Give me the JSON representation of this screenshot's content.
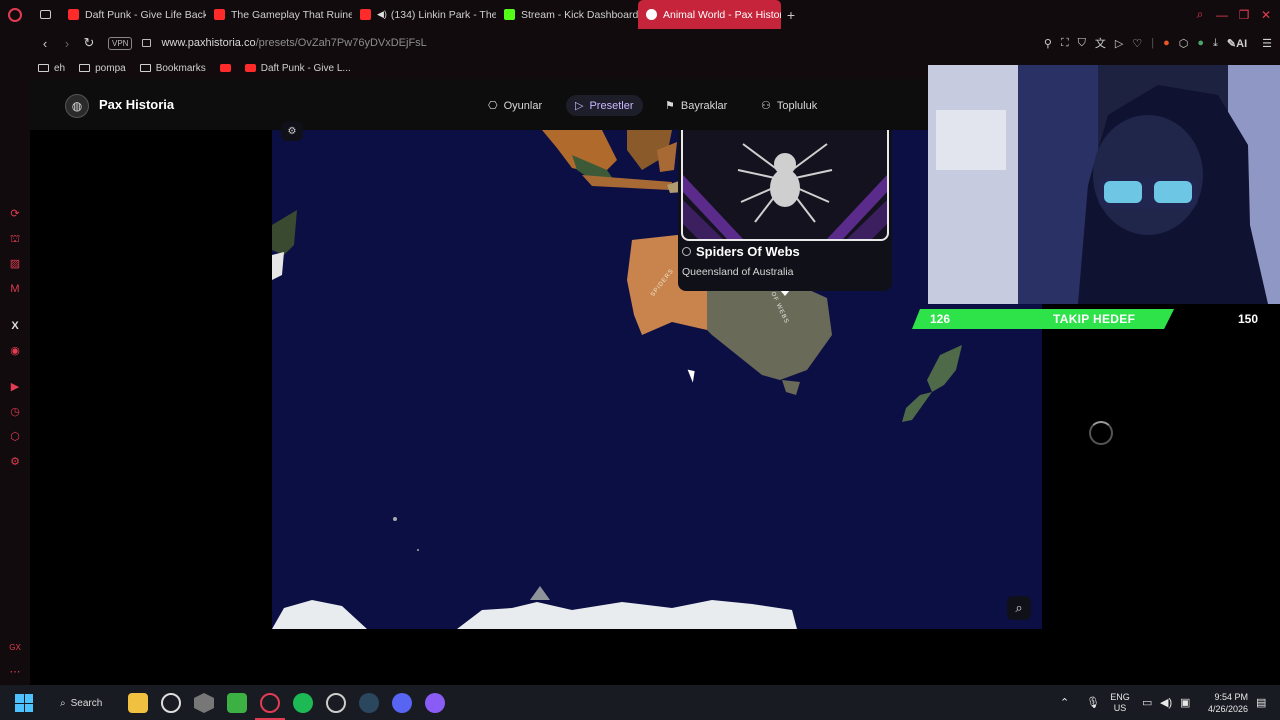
{
  "browser": {
    "tabs": [
      {
        "label": "Daft Punk - Give Life Back",
        "favicon": "youtube-icon",
        "active": false
      },
      {
        "label": "The Gameplay That Ruined",
        "favicon": "youtube-icon",
        "active": false
      },
      {
        "label": "(134) Linkin Park - The",
        "favicon": "youtube-icon",
        "active": false
      },
      {
        "label": "Stream - Kick Dashboard",
        "favicon": "kick-icon",
        "active": false
      },
      {
        "label": "Animal World - Pax Historia",
        "favicon": "globe-icon",
        "active": true
      }
    ],
    "vpn_label": "VPN",
    "url_host": "www.paxhistoria.co",
    "url_path": "/presets/OvZah7Pw76yDVxDEjFsL",
    "ai_label": "AI",
    "bookmarks": [
      {
        "label": "eh",
        "icon": "folder-icon"
      },
      {
        "label": "pompa",
        "icon": "folder-icon"
      },
      {
        "label": "Bookmarks",
        "icon": "folder-icon"
      },
      {
        "label": "",
        "icon": "youtube-icon"
      },
      {
        "label": "Daft Punk - Give L...",
        "icon": "youtube-icon"
      }
    ],
    "sidebar_footer": "GX"
  },
  "site": {
    "brand": "Pax Historia",
    "nav": [
      {
        "label": "Oyunlar",
        "icon": "gamepad-icon",
        "active": false
      },
      {
        "label": "Presetler",
        "icon": "play-icon",
        "active": true
      },
      {
        "label": "Bayraklar",
        "icon": "flag-icon",
        "active": false
      },
      {
        "label": "Topluluk",
        "icon": "users-icon",
        "active": false
      }
    ]
  },
  "map": {
    "card_title": "Spiders Of Webs",
    "card_subtitle": "Queensland of Australia",
    "label_west": "SPIDERS",
    "label_east": "OF WEBS"
  },
  "stream_overlay": {
    "goal_current": "126",
    "goal_label": "TAKIP HEDEF",
    "goal_target": "150",
    "goal_progress": 0.84
  },
  "taskbar": {
    "search_label": "Search",
    "lang_top": "ENG",
    "lang_bottom": "US",
    "time": "9:54 PM",
    "date": "4/26/2026"
  },
  "colors": {
    "accent": "#c6243a",
    "ocean": "#0c0f44",
    "goal_green": "#2ee24a"
  }
}
